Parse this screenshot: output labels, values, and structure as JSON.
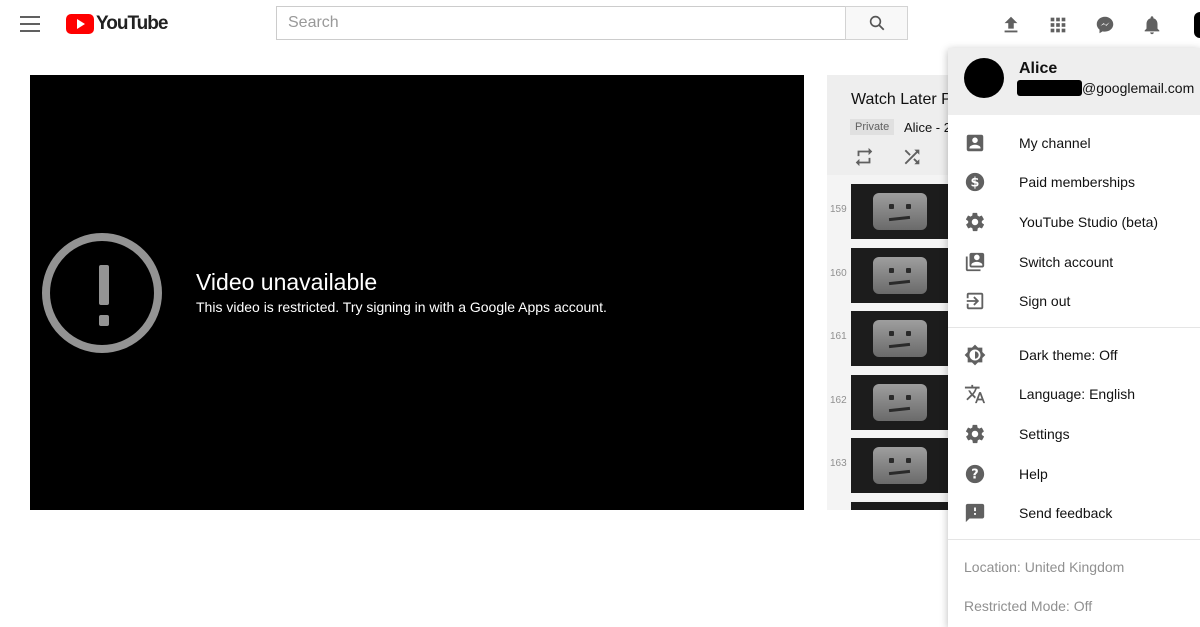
{
  "app": {
    "logo_text": "YouTube"
  },
  "header": {
    "search_placeholder": "Search",
    "icons": [
      "menu-icon",
      "upload-icon",
      "apps-grid-icon",
      "messages-icon",
      "notifications-icon"
    ]
  },
  "player": {
    "error_title": "Video unavailable",
    "error_message": "This video is restricted. Try signing in with a Google Apps account."
  },
  "playlist": {
    "title": "Watch Later P",
    "privacy_badge": "Private",
    "owner": "Alice - 2",
    "items": [
      {
        "index": "159"
      },
      {
        "index": "160"
      },
      {
        "index": "161"
      },
      {
        "index": "162"
      },
      {
        "index": "163"
      },
      {
        "index": ""
      }
    ]
  },
  "account_menu": {
    "name": "Alice",
    "email_suffix": "@googlemail.com",
    "primary_items": [
      {
        "label": "My channel",
        "icon": "account-box-icon"
      },
      {
        "label": "Paid memberships",
        "icon": "dollar-circle-icon"
      },
      {
        "label": "YouTube Studio (beta)",
        "icon": "gear-icon"
      },
      {
        "label": "Switch account",
        "icon": "switch-account-icon"
      },
      {
        "label": "Sign out",
        "icon": "sign-out-icon"
      }
    ],
    "secondary_items": [
      {
        "label": "Dark theme: Off",
        "icon": "dark-theme-icon"
      },
      {
        "label": "Language: English",
        "icon": "translate-icon"
      },
      {
        "label": "Settings",
        "icon": "gear-icon"
      },
      {
        "label": "Help",
        "icon": "help-icon"
      },
      {
        "label": "Send feedback",
        "icon": "feedback-icon"
      }
    ],
    "footer_items": [
      {
        "label": "Location: United Kingdom"
      },
      {
        "label": "Restricted Mode: Off"
      }
    ]
  },
  "colors": {
    "brand_red": "#ff0000",
    "icon_grey": "#606060",
    "muted_text": "#909090"
  }
}
